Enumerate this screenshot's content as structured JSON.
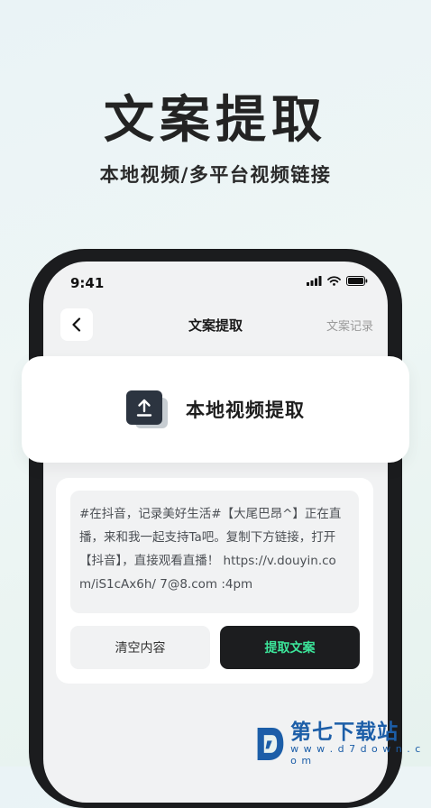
{
  "promo": {
    "headline": "文案提取",
    "subheadline": "本地视频/多平台视频链接"
  },
  "status_bar": {
    "time": "9:41"
  },
  "nav": {
    "title": "文案提取",
    "right_label": "文案记录",
    "back_icon": "chevron-left-icon"
  },
  "local_extract": {
    "label": "本地视频提取",
    "icon": "upload-icon"
  },
  "input": {
    "text": "#在抖音，记录美好生活#【大尾巴昂^】正在直播，来和我一起支持Ta吧。复制下方链接，打开【抖音】，直接观看直播！ https://v.douyin.com/iS1cAx6h/ 7@8.com :4pm"
  },
  "actions": {
    "clear_label": "清空内容",
    "extract_label": "提取文案"
  },
  "watermark": {
    "name": "第七下载站",
    "domain": "w w w . d 7 d o w n . c o m"
  },
  "colors": {
    "accent_green": "#3ce59a",
    "dark_button": "#1c1d1f",
    "watermark_blue": "#1c5ea8"
  }
}
